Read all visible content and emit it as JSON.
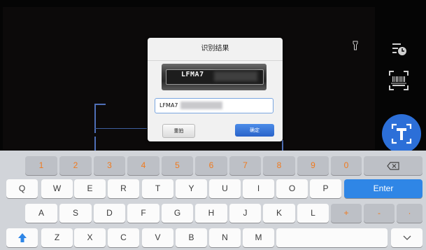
{
  "dialog": {
    "title": "识别结果",
    "plate_text": "LFMA7",
    "vin_value": "LFMA7",
    "retake_label": "重拍",
    "confirm_label": "确定"
  },
  "keyboard": {
    "digits": [
      "1",
      "2",
      "3",
      "4",
      "5",
      "6",
      "7",
      "8",
      "9",
      "0"
    ],
    "row1": [
      "Q",
      "W",
      "E",
      "R",
      "T",
      "Y",
      "U",
      "I",
      "O",
      "P"
    ],
    "enter_label": "Enter",
    "row2": [
      "A",
      "S",
      "D",
      "F",
      "G",
      "H",
      "J",
      "K",
      "L"
    ],
    "row2_symbols": [
      "+",
      "-",
      "·"
    ],
    "row3": [
      "Z",
      "X",
      "C",
      "V",
      "B",
      "N",
      "M"
    ]
  },
  "icons": {
    "torch": "torch-icon",
    "history": "history-icon",
    "barcode": "barcode-scan-icon",
    "ocr": "text-recognition-icon",
    "backspace": "backspace-icon",
    "shift": "shift-icon",
    "hide_keyboard": "chevron-down-icon"
  },
  "colors": {
    "accent": "#2f86e6",
    "digit": "#f07a1e",
    "scan_frame": "#4f6fb7"
  }
}
